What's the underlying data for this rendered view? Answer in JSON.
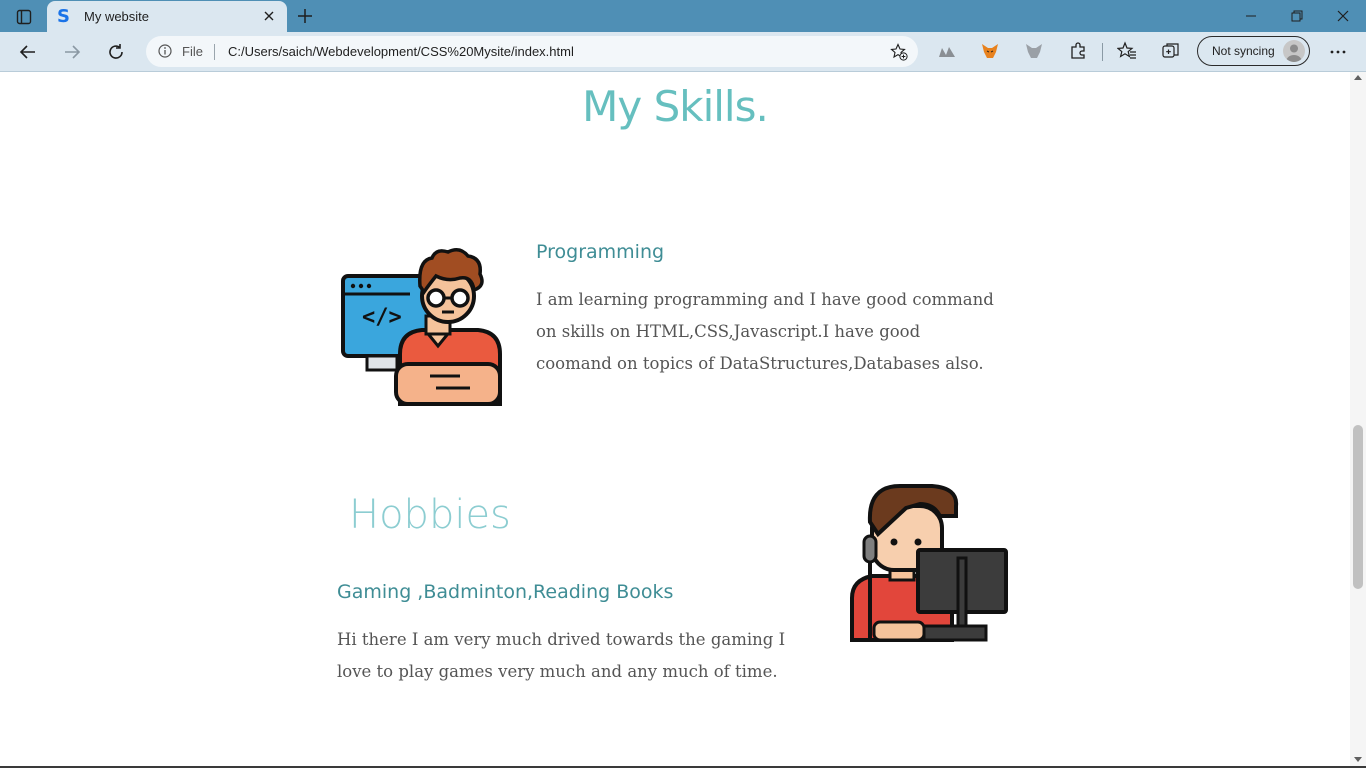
{
  "browser": {
    "tab": {
      "title": "My website",
      "favicon": "S"
    },
    "address": {
      "scheme_label": "File",
      "url": "C:/Users/saich/Webdevelopment/CSS%20Mysite/index.html"
    },
    "profile": {
      "label": "Not syncing"
    },
    "icons": [
      "tab-actions-icon",
      "close-icon",
      "plus-icon",
      "minimize-icon",
      "restore-icon",
      "window-close-icon",
      "back-arrow-icon",
      "forward-arrow-icon",
      "refresh-icon",
      "info-icon",
      "add-favorite-icon",
      "extension-icon",
      "fox-extension-icon",
      "puzzle-icon",
      "favorites-icon",
      "collections-icon",
      "more-icon"
    ]
  },
  "page": {
    "skills_title": "My Skills.",
    "programming": {
      "heading": "Programming",
      "paragraph": "I am learning programming and I have good command on skills on HTML,CSS,Javascript.I have good coomand on topics of DataStructures,Databases also."
    },
    "hobbies": {
      "title": "Hobbies",
      "heading": "Gaming ,Badminton,Reading Books",
      "paragraph": "Hi there I am very much drived towards the gaming I love to play games very much and any much of time."
    }
  },
  "colors": {
    "heading": "#66bfbf",
    "subheading": "#3f8d95",
    "body_text": "#555555",
    "chrome": "#4f8fb5"
  }
}
